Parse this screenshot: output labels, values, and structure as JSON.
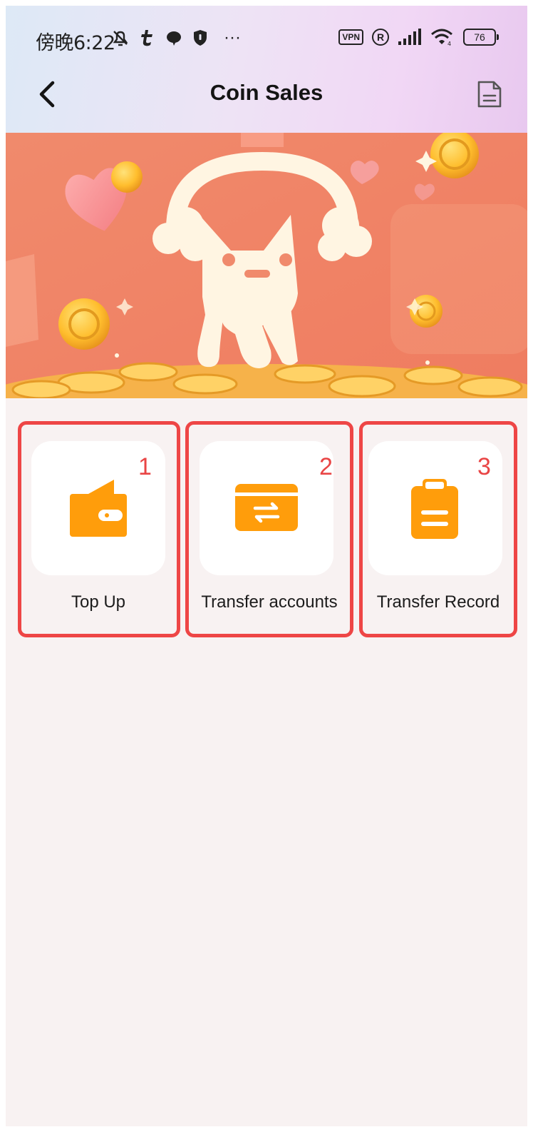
{
  "status_bar": {
    "time": "傍晚6:22",
    "more": "···",
    "vpn": "VPN",
    "registered": "R",
    "battery": "76"
  },
  "header": {
    "title": "Coin Sales"
  },
  "features": [
    {
      "label": "Top Up",
      "badge": "1",
      "icon": "wallet-icon"
    },
    {
      "label": "Transfer accounts",
      "badge": "2",
      "icon": "transfer-card-icon"
    },
    {
      "label": "Transfer Record",
      "badge": "3",
      "icon": "clipboard-icon"
    }
  ],
  "colors": {
    "accent": "#ff9d0b",
    "banner": "#f2876a",
    "highlight": "#ee4646",
    "background": "#f8f2f2"
  }
}
